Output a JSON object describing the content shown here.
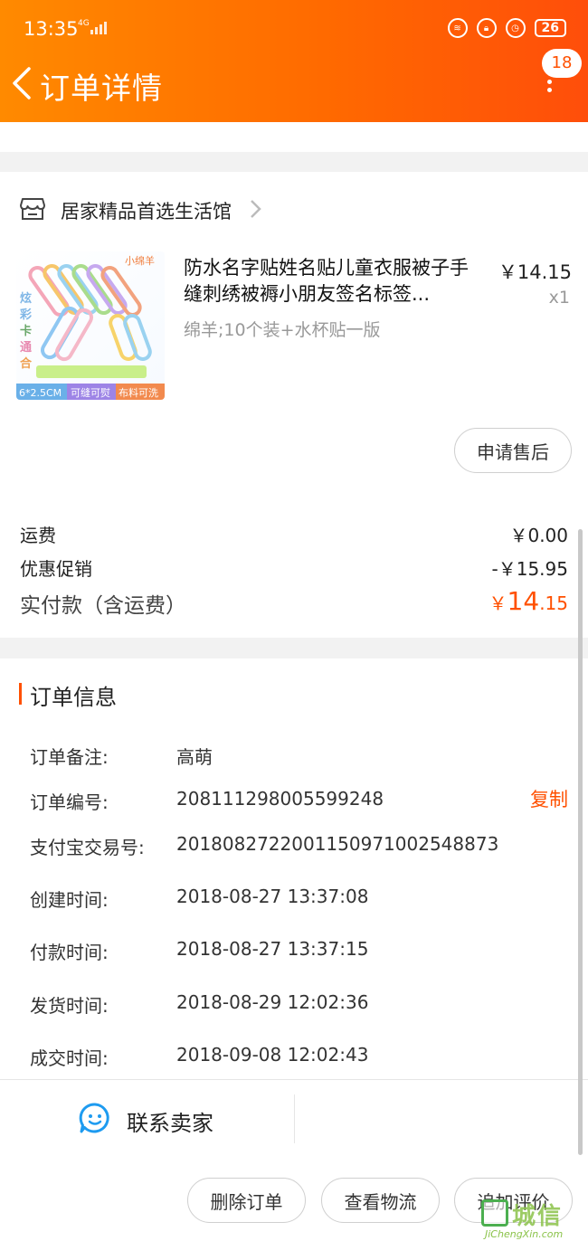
{
  "status_bar": {
    "time": "13:35",
    "network": "4G",
    "battery": "26"
  },
  "header": {
    "title": "订单详情",
    "badge": "18"
  },
  "shop": {
    "name": "居家精品首选生活馆"
  },
  "product": {
    "title": "防水名字贴姓名贴儿童衣服被子手缝刺绣被褥小朋友签名标签...",
    "sku": "绵羊;10个装+水杯贴一版",
    "price": "￥14.15",
    "quantity": "x1",
    "image_tags": [
      "6*2.5CM",
      "可缝可熨",
      "布料可洗"
    ],
    "image_text": "小绵羊"
  },
  "after_sale_button": "申请售后",
  "fees": {
    "shipping_label": "运费",
    "shipping_value": "￥0.00",
    "discount_label": "优惠促销",
    "discount_value": "-￥15.95",
    "total_label": "实付款（含运费）",
    "total_currency": "￥",
    "total_int": "14",
    "total_dec": ".15"
  },
  "order_info": {
    "title": "订单信息",
    "copy_label": "复制",
    "rows": [
      {
        "label": "订单备注:",
        "value": "高萌"
      },
      {
        "label": "订单编号:",
        "value": "208111298005599248"
      },
      {
        "label": "支付宝交易号:",
        "value": "2018082722001150971002548873"
      },
      {
        "label": "创建时间:",
        "value": "2018-08-27 13:37:08"
      },
      {
        "label": "付款时间:",
        "value": "2018-08-27 13:37:15"
      },
      {
        "label": "发货时间:",
        "value": "2018-08-29 12:02:36"
      },
      {
        "label": "成交时间:",
        "value": "2018-09-08 12:02:43"
      }
    ]
  },
  "contact": {
    "label": "联系卖家"
  },
  "bottom_actions": {
    "delete": "删除订单",
    "logistics": "查看物流",
    "review": "追加评价"
  },
  "watermark": {
    "text": "城信",
    "sub": "JiChengXin.com"
  },
  "colors": {
    "accent": "#ff5000",
    "header_start": "#ff8a00",
    "header_end": "#ff4e0a"
  }
}
